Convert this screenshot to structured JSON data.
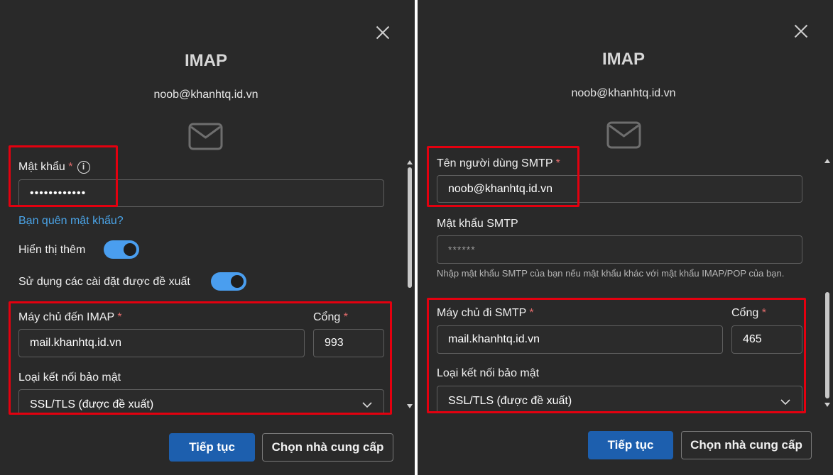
{
  "left": {
    "title": "IMAP",
    "email": "noob@khanhtq.id.vn",
    "password": {
      "label": "Mật khẩu",
      "required_mark": "*",
      "value": "••••••••••••",
      "forgot_link": "Bạn quên mật khẩu?"
    },
    "toggles": [
      {
        "label": "Hiển thị thêm",
        "state": "on"
      },
      {
        "label": "Sử dụng các cài đặt được đề xuất",
        "state": "on"
      }
    ],
    "server": {
      "label": "Máy chủ đến IMAP",
      "required_mark": "*",
      "value": "mail.khanhtq.id.vn"
    },
    "port": {
      "label": "Cổng",
      "required_mark": "*",
      "value": "993"
    },
    "security": {
      "label": "Loại kết nối bảo mật",
      "value": "SSL/TLS (được đề xuất)"
    },
    "buttons": {
      "continue": "Tiếp tục",
      "choose_provider": "Chọn nhà cung cấp"
    }
  },
  "right": {
    "title": "IMAP",
    "email": "noob@khanhtq.id.vn",
    "smtp_username": {
      "label": "Tên người dùng SMTP",
      "required_mark": "*",
      "value": "noob@khanhtq.id.vn"
    },
    "smtp_password": {
      "label": "Mật khẩu SMTP",
      "placeholder": "******",
      "hint": "Nhập mật khẩu SMTP của bạn nếu mật khẩu khác với mật khẩu IMAP/POP của bạn."
    },
    "server": {
      "label": "Máy chủ đi SMTP",
      "required_mark": "*",
      "value": "mail.khanhtq.id.vn"
    },
    "port": {
      "label": "Cổng",
      "required_mark": "*",
      "value": "465"
    },
    "security": {
      "label": "Loại kết nối bảo mật",
      "value": "SSL/TLS (được đề xuất)"
    },
    "buttons": {
      "continue": "Tiếp tục",
      "choose_provider": "Chọn nhà cung cấp"
    }
  },
  "colors": {
    "background": "#292929",
    "accent": "#1d5fae",
    "toggle_on": "#4a9eef",
    "link": "#4aa3e6",
    "required": "#e26b6b",
    "highlight_box": "#e3000f"
  },
  "icons": [
    "close-icon",
    "mail-icon",
    "info-icon",
    "chevron-down-icon"
  ]
}
